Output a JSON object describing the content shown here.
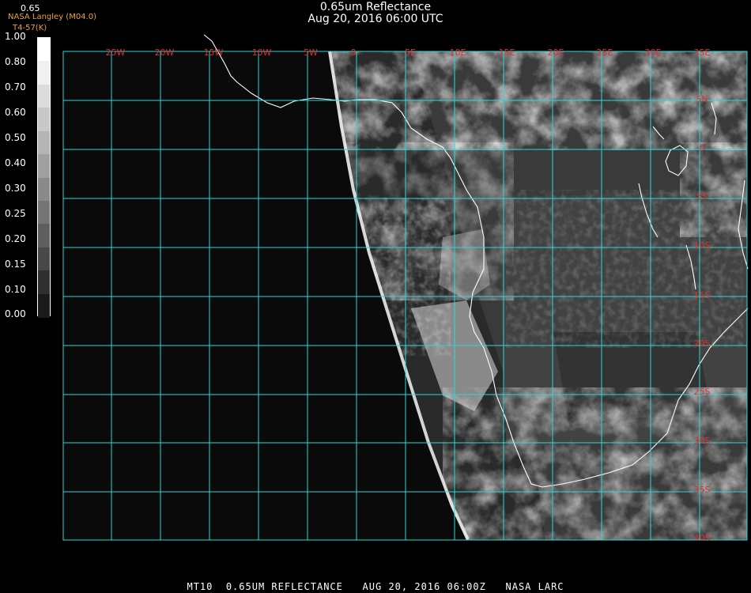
{
  "header": {
    "title_line1": "0.65um Reflectance",
    "title_line2": "Aug 20, 2016 06:00 UTC",
    "credit_line1": "NASA Langley (M04.0)",
    "credit_line2": "T4-57(K)",
    "colorbar_top_label": "0.65"
  },
  "colorbar": {
    "ticks": [
      "1.00",
      "0.80",
      "0.70",
      "0.60",
      "0.50",
      "0.40",
      "0.30",
      "0.25",
      "0.20",
      "0.15",
      "0.10",
      "0.00"
    ]
  },
  "map": {
    "longitude_labels": [
      "25W",
      "20W",
      "15W",
      "10W",
      "5W",
      "0",
      "5E",
      "10E",
      "15E",
      "20E",
      "25E",
      "30E",
      "35E"
    ],
    "latitude_labels": [
      "5N",
      "0",
      "5S",
      "10S",
      "15S",
      "20S",
      "25S",
      "30S",
      "35S",
      "40S"
    ],
    "grid_color": "#2fd6d6",
    "coastline_color": "#ffffff",
    "label_color": "#e03030"
  },
  "footer": {
    "text": "MT10  0.65UM REFLECTANCE   AUG 20, 2016 06:00Z   NASA LARC"
  }
}
